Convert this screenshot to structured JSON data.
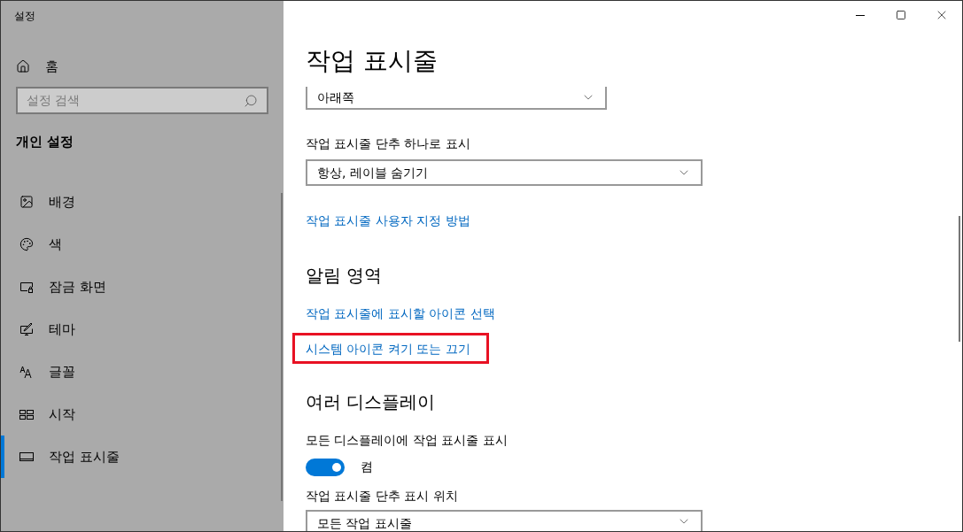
{
  "window": {
    "title": "설정"
  },
  "sidebar": {
    "home": "홈",
    "search": {
      "placeholder": "설정 검색"
    },
    "group": "개인 설정",
    "items": [
      {
        "kind": "background",
        "label": "배경",
        "selected": false
      },
      {
        "kind": "color",
        "label": "색",
        "selected": false
      },
      {
        "kind": "lock_screen",
        "label": "잠금 화면",
        "selected": false
      },
      {
        "kind": "theme",
        "label": "테마",
        "selected": false
      },
      {
        "kind": "fonts",
        "label": "글꼴",
        "selected": false
      },
      {
        "kind": "start",
        "label": "시작",
        "selected": false
      },
      {
        "kind": "taskbar",
        "label": "작업 표시줄",
        "selected": true
      }
    ]
  },
  "page": {
    "title": "작업 표시줄",
    "sections": [
      {
        "kind": "dropdown",
        "value": "아래쪽",
        "cut_top": true
      },
      {
        "kind": "label",
        "text": "작업 표시줄 단추 하나로 표시"
      },
      {
        "kind": "dropdown",
        "value": "항상, 레이블 숨기기"
      },
      {
        "kind": "link",
        "text": "작업 표시줄 사용자 지정 방법",
        "highlighted": false
      },
      {
        "kind": "heading",
        "text": "알림 영역"
      },
      {
        "kind": "link",
        "text": "작업 표시줄에 표시할 아이콘 선택",
        "highlighted": false
      },
      {
        "kind": "link",
        "text": "시스템 아이콘 켜기 또는 끄기",
        "highlighted": true
      },
      {
        "kind": "heading",
        "text": "여러 디스플레이"
      },
      {
        "kind": "label",
        "text": "모든 디스플레이에 작업 표시줄 표시"
      },
      {
        "kind": "toggle",
        "on": true,
        "state_text": "켬"
      },
      {
        "kind": "label",
        "text": "작업 표시줄 단추 표시 위치"
      },
      {
        "kind": "dropdown",
        "value": "모든 작업 표시줄"
      }
    ]
  }
}
